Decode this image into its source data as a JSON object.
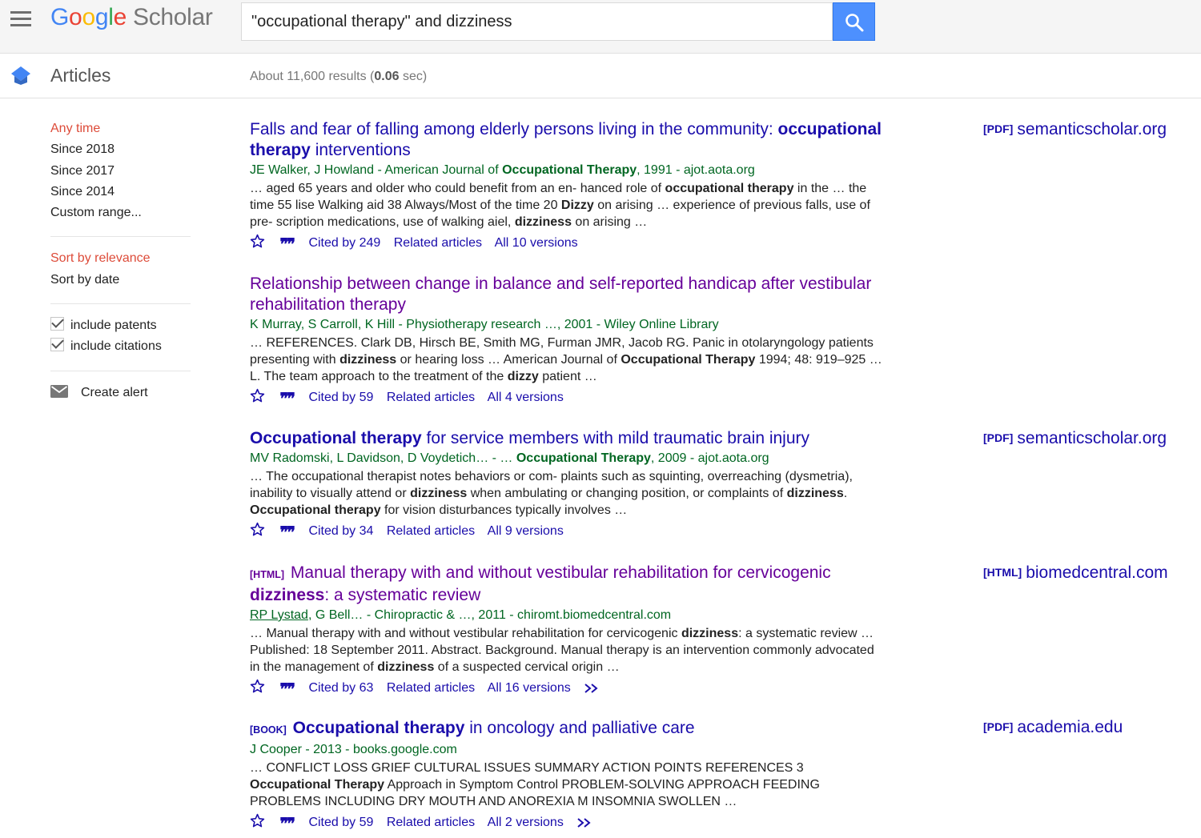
{
  "header": {
    "logo": {
      "google_letters": [
        "G",
        "o",
        "o",
        "g",
        "l",
        "e"
      ],
      "scholar": "Scholar"
    },
    "search": {
      "query": "\"occupational therapy\" and dizziness"
    },
    "icons": {
      "menu": "hamburger-menu-icon",
      "search": "magnifier-icon"
    },
    "colors": {
      "search_button": "#4d90fe"
    }
  },
  "subheader": {
    "section_label": "Articles",
    "stats_prefix": "About 11,600 results (",
    "stats_time": "0.06",
    "stats_suffix": " sec)"
  },
  "sidebar": {
    "time_filters": [
      "Any time",
      "Since 2018",
      "Since 2017",
      "Since 2014",
      "Custom range..."
    ],
    "selected_time": "Any time",
    "sort_options": [
      "Sort by relevance",
      "Sort by date"
    ],
    "selected_sort": "Sort by relevance",
    "checkboxes": [
      {
        "label": "include patents",
        "checked": true
      },
      {
        "label": "include citations",
        "checked": true
      }
    ],
    "create_alert": "Create alert"
  },
  "results": [
    {
      "tag": "",
      "title_parts": [
        "Falls and fear of falling among elderly persons living in the community: ",
        "occupational therapy",
        " interventions"
      ],
      "meta_parts": [
        "JE Walker, J Howland - American Journal of ",
        "Occupational Therapy",
        ", 1991 - ajot.aota.org"
      ],
      "snippet_parts": [
        "… aged 65 years and older who could benefit from an en- hanced role of ",
        "occupational therapy",
        " in the … the time 55 lise Walking aid 38 Always/Most of the time 20 ",
        "Dizzy",
        " on arising … experience of previous falls, use of pre- scription medications, use of walking aiel, ",
        "dizziness",
        " on arising …"
      ],
      "cited_by": "Cited by 249",
      "related": "Related articles",
      "versions": "All 10 versions",
      "side_tag": "[PDF]",
      "side_source": "semanticscholar.org"
    },
    {
      "tag": "",
      "title_parts": [
        "Relationship between change in balance and self-reported handicap after vestibular rehabilitation therapy"
      ],
      "meta_parts": [
        "K Murray, S Carroll, K Hill - Physiotherapy research …, 2001 - Wiley Online Library"
      ],
      "snippet_parts": [
        "… REFERENCES. Clark DB, Hirsch BE, Smith MG, Furman JMR, Jacob RG. Panic in otolaryngology patients presenting with ",
        "dizziness",
        " or hearing loss … American Journal of ",
        "Occupational Therapy",
        " 1994; 48: 919–925 … L. The team approach to the treatment of the ",
        "dizzy",
        " patient …"
      ],
      "cited_by": "Cited by 59",
      "related": "Related articles",
      "versions": "All 4 versions",
      "side_tag": "",
      "side_source": ""
    },
    {
      "tag": "",
      "title_parts": [
        "Occupational therapy",
        " for service members with mild traumatic brain injury"
      ],
      "meta_parts": [
        "MV Radomski, L Davidson, D Voydetich… - … ",
        "Occupational Therapy",
        ", 2009 - ajot.aota.org"
      ],
      "snippet_parts": [
        "… The occupational therapist notes behaviors or com- plaints such as squinting, overreaching (dysmetria), inability to visually attend or ",
        "dizziness",
        " when ambulating or changing position, or complaints of ",
        "dizziness",
        ". ",
        "Occupational therapy",
        " for vision disturbances typically involves …"
      ],
      "cited_by": "Cited by 34",
      "related": "Related articles",
      "versions": "All 9 versions",
      "side_tag": "[PDF]",
      "side_source": "semanticscholar.org"
    },
    {
      "tag": "[HTML]",
      "title_parts": [
        "Manual therapy with and without vestibular rehabilitation for cervicogenic ",
        "dizziness",
        ": a systematic review"
      ],
      "meta_parts": [
        "RP Lystad",
        ", G Bell… - Chiropractic & …, 2011 - chiromt.biomedcentral.com"
      ],
      "snippet_parts": [
        "… Manual therapy with and without vestibular rehabilitation for cervicogenic ",
        "dizziness",
        ": a systematic review … Published: 18 September 2011. Abstract. Background. Manual therapy is an intervention commonly advocated in the management of ",
        "dizziness",
        " of a suspected cervical origin …"
      ],
      "cited_by": "Cited by 63",
      "related": "Related articles",
      "versions": "All 16 versions",
      "side_tag": "[HTML]",
      "side_source": "biomedcentral.com"
    },
    {
      "tag": "[BOOK]",
      "title_parts": [
        "Occupational therapy",
        " in oncology and palliative care"
      ],
      "meta_parts": [
        "J Cooper - 2013 - books.google.com"
      ],
      "snippet_parts": [
        "… CONFLICT LOSS GRIEF CULTURAL ISSUES SUMMARY ACTION POINTS REFERENCES 3 ",
        "Occupational Therapy",
        " Approach in Symptom Control PROBLEM-SOLVING APPROACH FEEDING PROBLEMS INCLUDING DRY MOUTH AND ANOREXIA M INSOMNIA SWOLLEN …"
      ],
      "cited_by": "Cited by 59",
      "related": "Related articles",
      "versions": "All 2 versions",
      "side_tag": "[PDF]",
      "side_source": "academia.edu"
    }
  ]
}
